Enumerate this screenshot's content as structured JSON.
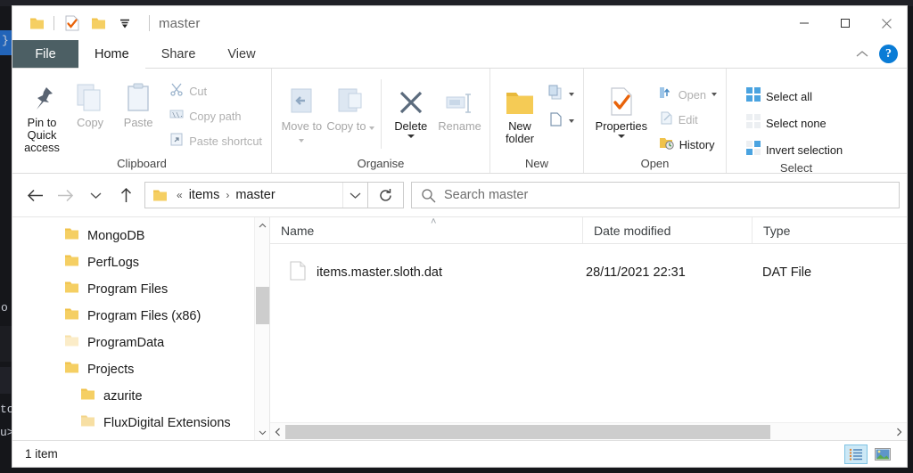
{
  "window": {
    "title": "master",
    "quick_access": [
      "folder-icon",
      "properties-check-icon",
      "folder-icon",
      "customize-dropdown-icon"
    ],
    "controls": {
      "minimize": "minimize-icon",
      "maximize": "maximize-icon",
      "close": "close-icon"
    }
  },
  "ribbon": {
    "tabs": [
      {
        "label": "File",
        "active": false,
        "style": "file"
      },
      {
        "label": "Home",
        "active": true,
        "style": "normal"
      },
      {
        "label": "Share",
        "active": false,
        "style": "normal"
      },
      {
        "label": "View",
        "active": false,
        "style": "normal"
      }
    ],
    "collapse_icon": "chevron-up-icon",
    "help_label": "?",
    "groups": [
      {
        "name": "Clipboard",
        "label": "Clipboard",
        "big": [
          {
            "label": "Pin to Quick access",
            "icon": "pin-icon",
            "disabled": false
          },
          {
            "label": "Copy",
            "icon": "copy-icon",
            "disabled": true
          },
          {
            "label": "Paste",
            "icon": "paste-icon",
            "disabled": true
          }
        ],
        "small": [
          {
            "label": "Cut",
            "icon": "scissors-icon",
            "disabled": true
          },
          {
            "label": "Copy path",
            "icon": "copy-path-icon",
            "disabled": true
          },
          {
            "label": "Paste shortcut",
            "icon": "paste-shortcut-icon",
            "disabled": true
          }
        ]
      },
      {
        "name": "Organise",
        "label": "Organise",
        "big": [
          {
            "label": "Move to",
            "icon": "move-to-icon",
            "disabled": true,
            "dropdown": true
          },
          {
            "label": "Copy to",
            "icon": "copy-to-icon",
            "disabled": true,
            "dropdown": true
          },
          {
            "label": "Delete",
            "icon": "delete-x-icon",
            "disabled": false,
            "dropdown": true
          },
          {
            "label": "Rename",
            "icon": "rename-icon",
            "disabled": true
          }
        ]
      },
      {
        "name": "New",
        "label": "New",
        "big": [
          {
            "label": "New folder",
            "icon": "new-folder-icon",
            "disabled": false
          }
        ],
        "small": [
          {
            "label": "",
            "icon": "new-item-icon",
            "dropdown": true
          },
          {
            "label": "",
            "icon": "easy-access-icon",
            "dropdown": true
          }
        ]
      },
      {
        "name": "Open",
        "label": "Open",
        "big": [
          {
            "label": "Properties",
            "icon": "properties-check-icon",
            "disabled": false,
            "dropdown": true
          }
        ],
        "small": [
          {
            "label": "Open",
            "icon": "open-icon",
            "disabled": true,
            "dropdown": true
          },
          {
            "label": "Edit",
            "icon": "edit-icon",
            "disabled": true
          },
          {
            "label": "History",
            "icon": "history-icon",
            "disabled": false
          }
        ]
      },
      {
        "name": "Select",
        "label": "Select",
        "small": [
          {
            "label": "Select all",
            "icon": "select-all-icon",
            "disabled": false
          },
          {
            "label": "Select none",
            "icon": "select-none-icon",
            "disabled": true
          },
          {
            "label": "Invert selection",
            "icon": "invert-selection-icon",
            "disabled": false
          }
        ]
      }
    ]
  },
  "address": {
    "back_icon": "arrow-left-icon",
    "forward_icon": "arrow-right-icon",
    "recent_icon": "chevron-down-icon",
    "up_icon": "arrow-up-icon",
    "folder_icon": "folder-icon",
    "overflow": "«",
    "crumbs": [
      "items",
      "master"
    ],
    "separator": "›",
    "dropdown_icon": "chevron-down-icon",
    "refresh_icon": "refresh-icon"
  },
  "search": {
    "icon": "search-icon",
    "placeholder": "Search master",
    "value": ""
  },
  "nav_pane": {
    "items": [
      {
        "label": "MongoDB",
        "indent": 0,
        "faded": false
      },
      {
        "label": "PerfLogs",
        "indent": 0,
        "faded": false
      },
      {
        "label": "Program Files",
        "indent": 0,
        "faded": false
      },
      {
        "label": "Program Files (x86)",
        "indent": 0,
        "faded": false
      },
      {
        "label": "ProgramData",
        "indent": 0,
        "faded": true
      },
      {
        "label": "Projects",
        "indent": 0,
        "faded": false
      },
      {
        "label": "azurite",
        "indent": 1,
        "faded": false
      },
      {
        "label": "FluxDigital Extensions",
        "indent": 1,
        "faded": true
      }
    ],
    "scroll_up_icon": "chevron-up-icon",
    "scroll_down_icon": "chevron-down-icon"
  },
  "file_list": {
    "columns": [
      {
        "key": "name",
        "label": "Name",
        "sorted": true
      },
      {
        "key": "date",
        "label": "Date modified",
        "sorted": false
      },
      {
        "key": "type",
        "label": "Type",
        "sorted": false
      }
    ],
    "sort_indicator": "˄",
    "rows": [
      {
        "icon": "dat-file-icon",
        "name": "items.master.sloth.dat",
        "date": "28/11/2021 22:31",
        "type": "DAT File"
      }
    ],
    "hscroll_left_icon": "chevron-left-icon",
    "hscroll_right_icon": "chevron-right-icon"
  },
  "status": {
    "text": "1 item",
    "views": [
      {
        "name": "details-view",
        "icon": "details-view-icon",
        "active": true
      },
      {
        "name": "large-icons-view",
        "icon": "large-icons-view-icon",
        "active": false
      }
    ]
  },
  "colors": {
    "folder": "#f5c842",
    "accent_blue": "#0a7cd6",
    "file_tab": "#4c5f64",
    "orange_check": "#e8630a",
    "selection": "#cce8f6"
  }
}
